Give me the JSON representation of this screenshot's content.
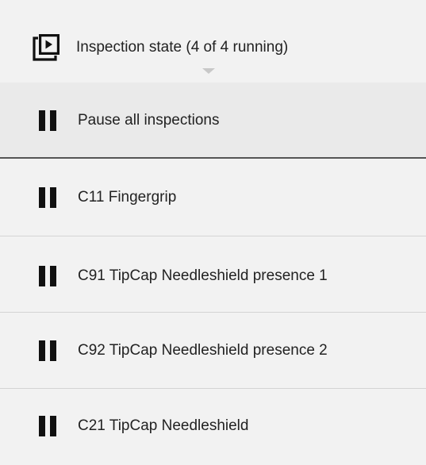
{
  "header": {
    "title": "Inspection state (4 of 4 running)",
    "icon": "play-slides-icon"
  },
  "master_action": {
    "label": "Pause all inspections",
    "icon": "pause-icon"
  },
  "inspections": [
    {
      "label": "C11 Fingergrip",
      "icon": "pause-icon"
    },
    {
      "label": "C91 TipCap Needleshield presence 1",
      "icon": "pause-icon"
    },
    {
      "label": "C92 TipCap Needleshield presence 2",
      "icon": "pause-icon"
    },
    {
      "label": "C21 TipCap Needleshield",
      "icon": "pause-icon"
    }
  ],
  "colors": {
    "background": "#f2f2f2",
    "master_row_background": "#eaeaea",
    "divider": "#d4d4d4",
    "master_divider": "#555555",
    "icon": "#111111"
  }
}
